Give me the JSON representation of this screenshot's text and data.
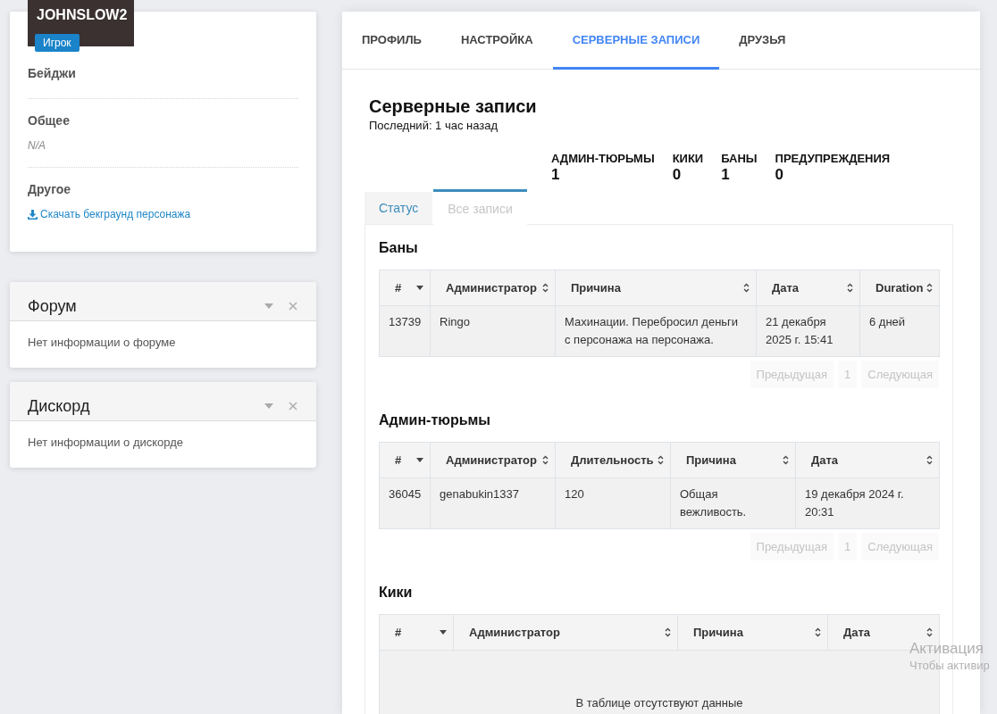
{
  "profile": {
    "username": "JOHNSLOW2",
    "role": "Игрок",
    "sections": [
      {
        "title": "Бейджи"
      },
      {
        "title": "Общее",
        "items": [
          {
            "kind": "note",
            "text": "N/A"
          }
        ]
      },
      {
        "title": "Другое",
        "items": [
          {
            "kind": "download_link",
            "text": "Скачать бекграунд персонажа"
          }
        ]
      }
    ]
  },
  "widgets": [
    {
      "title": "Форум",
      "body": "Нет информации о форуме"
    },
    {
      "title": "Дискорд",
      "body": "Нет информации о дискорде"
    }
  ],
  "main": {
    "tabs": [
      {
        "label": "ПРОФИЛЬ",
        "selected": false
      },
      {
        "label": "НАСТРОЙКА",
        "selected": false
      },
      {
        "label": "СЕРВЕРНЫЕ ЗАПИСИ",
        "selected": true
      },
      {
        "label": "ДРУЗЬЯ",
        "selected": false
      }
    ],
    "title": "Серверные записи",
    "subtitle": "Последний: 1 час назад",
    "stats": [
      {
        "label": "АДМИН-ТЮРЬМЫ",
        "value": "1"
      },
      {
        "label": "КИКИ",
        "value": "0"
      },
      {
        "label": "БАНЫ",
        "value": "1"
      },
      {
        "label": "ПРЕДУПРЕЖДЕНИЯ",
        "value": "0"
      }
    ],
    "record_tabs": [
      {
        "label": "Статус",
        "selected": false
      },
      {
        "label": "Все записи",
        "selected": true
      }
    ],
    "tables": [
      {
        "title": "Баны",
        "columns": [
          {
            "label": "#",
            "sorted": true
          },
          {
            "label": "Администратор",
            "sorted": false
          },
          {
            "label": "Причина",
            "sorted": false
          },
          {
            "label": "Дата",
            "sorted": false
          },
          {
            "label": "Duration",
            "sorted": false
          }
        ],
        "rows": [
          [
            "13739",
            "Ringo",
            "Махинации. Перебросил деньги с персонажа на персонажа.",
            "21 декабря 2025 г. 15:41",
            "6 дней"
          ]
        ],
        "pagination": {
          "previous": {
            "label": "Предыдущая",
            "disabled": true
          },
          "page": "1",
          "next": {
            "label": "Следующая",
            "disabled": true
          }
        }
      },
      {
        "title": "Админ-тюрьмы",
        "columns": [
          {
            "label": "#",
            "sorted": true
          },
          {
            "label": "Администратор",
            "sorted": false
          },
          {
            "label": "Длительность",
            "sorted": false
          },
          {
            "label": "Причина",
            "sorted": false
          },
          {
            "label": "Дата",
            "sorted": false
          }
        ],
        "rows": [
          [
            "36045",
            "genabukin1337",
            "120",
            "Общая вежливость.",
            "19 декабря 2024 г. 20:31"
          ]
        ],
        "pagination": {
          "previous": {
            "label": "Предыдущая",
            "disabled": true
          },
          "page": "1",
          "next": {
            "label": "Следующая",
            "disabled": true
          }
        }
      },
      {
        "title": "Кики",
        "columns": [
          {
            "label": "#",
            "sorted": true
          },
          {
            "label": "Администратор",
            "sorted": false
          },
          {
            "label": "Причина",
            "sorted": false
          },
          {
            "label": "Дата",
            "sorted": false
          }
        ],
        "empty_text": "В таблице отсутствуют данные"
      }
    ]
  },
  "os_notice": {
    "title": "Активация",
    "text": "Чтобы активир"
  }
}
